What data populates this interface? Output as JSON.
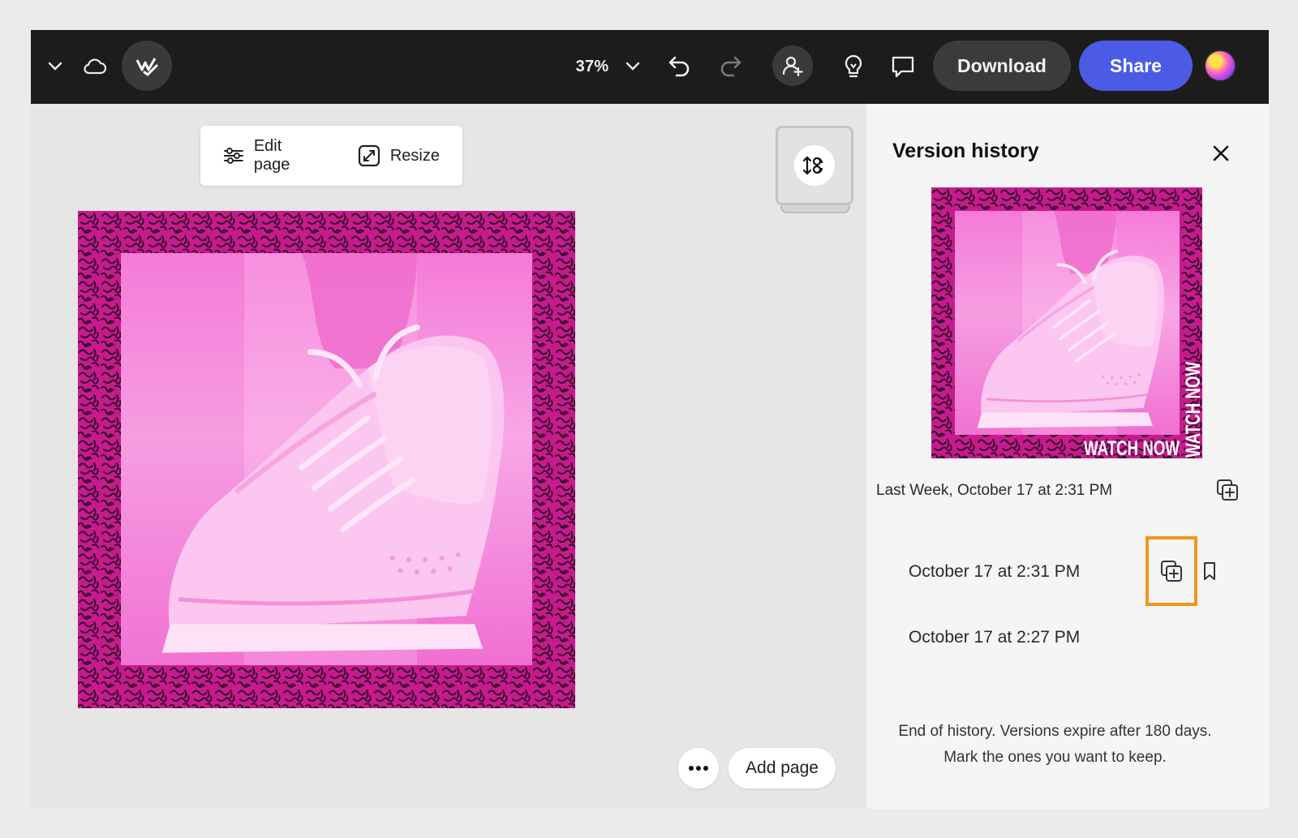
{
  "toolbar": {
    "zoom": "37%",
    "download_label": "Download",
    "share_label": "Share"
  },
  "page_tools": {
    "edit_page_label": "Edit page",
    "resize_label": "Resize"
  },
  "artwork": {
    "overlay_text": "WATCH NOW",
    "frame_color": "#c71a8f",
    "photo_tint": "#f58ee0"
  },
  "canvas_footer": {
    "add_page_label": "Add page"
  },
  "version_panel": {
    "title": "Version history",
    "current_version": "Last Week, October 17 at 2:31 PM",
    "versions": [
      {
        "label": "October 17 at 2:31 PM"
      },
      {
        "label": "October 17 at 2:27 PM"
      }
    ],
    "end_note_line1": "End of history. Versions expire after 180 days.",
    "end_note_line2": "Mark the ones you want to keep."
  },
  "colors": {
    "topbar": "#1c1c1c",
    "share": "#4b5be6",
    "highlight": "#f0971c"
  }
}
